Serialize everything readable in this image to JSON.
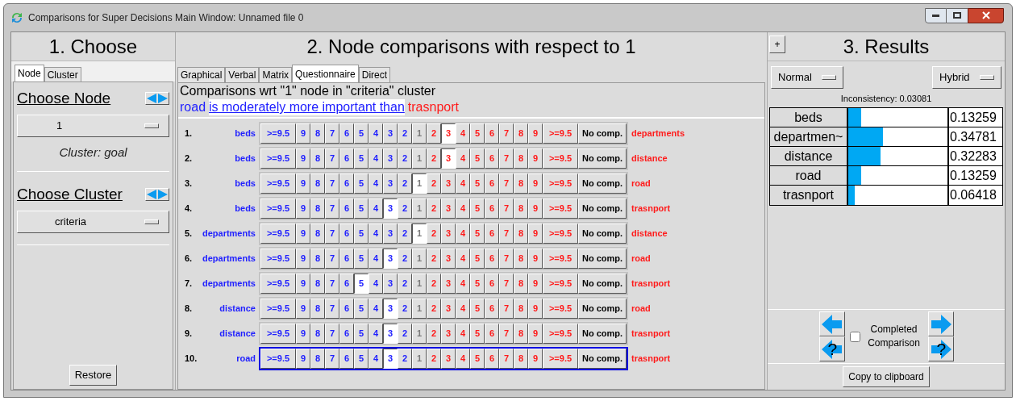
{
  "window": {
    "title": "Comparisons for Super Decisions Main Window: Unnamed file 0"
  },
  "choose": {
    "title": "1. Choose",
    "tabs": [
      {
        "label": "Node",
        "selected": true
      },
      {
        "label": "Cluster",
        "selected": false
      }
    ],
    "node_heading": "Choose Node",
    "node_value": "1",
    "cluster_note": "Cluster: goal",
    "cluster_heading": "Choose Cluster",
    "cluster_value": "criteria",
    "restore": "Restore"
  },
  "comparisons": {
    "title": "2. Node comparisons with respect to 1",
    "tabs": [
      {
        "label": "Graphical",
        "selected": false
      },
      {
        "label": "Verbal",
        "selected": false
      },
      {
        "label": "Matrix",
        "selected": false
      },
      {
        "label": "Questionnaire",
        "selected": true
      },
      {
        "label": "Direct",
        "selected": false
      }
    ],
    "heading": "Comparisons wrt \"1\" node in \"criteria\" cluster",
    "statement": {
      "left": "road",
      "verb": "is moderately more important than",
      "right": "trasnport"
    },
    "rows": [
      {
        "number": "1.",
        "left": "beds",
        "right": "departments",
        "active": false,
        "left_buttons": [
          {
            "label": ">=9.5",
            "selected": false
          },
          {
            "label": "9",
            "selected": false
          },
          {
            "label": "8",
            "selected": false
          },
          {
            "label": "7",
            "selected": false
          },
          {
            "label": "6",
            "selected": false
          },
          {
            "label": "5",
            "selected": false
          },
          {
            "label": "4",
            "selected": false
          },
          {
            "label": "3",
            "selected": false
          },
          {
            "label": "2",
            "selected": false
          }
        ],
        "equal": {
          "label": "1",
          "selected": false
        },
        "right_buttons": [
          {
            "label": "2",
            "selected": false
          },
          {
            "label": "3",
            "selected": true
          },
          {
            "label": "4",
            "selected": false
          },
          {
            "label": "5",
            "selected": false
          },
          {
            "label": "6",
            "selected": false
          },
          {
            "label": "7",
            "selected": false
          },
          {
            "label": "8",
            "selected": false
          },
          {
            "label": "9",
            "selected": false
          },
          {
            "label": ">=9.5",
            "selected": false
          }
        ],
        "no_comp": {
          "label": "No comp.",
          "selected": false
        }
      },
      {
        "number": "2.",
        "left": "beds",
        "right": "distance",
        "active": false,
        "left_buttons": [
          {
            "label": ">=9.5",
            "selected": false
          },
          {
            "label": "9",
            "selected": false
          },
          {
            "label": "8",
            "selected": false
          },
          {
            "label": "7",
            "selected": false
          },
          {
            "label": "6",
            "selected": false
          },
          {
            "label": "5",
            "selected": false
          },
          {
            "label": "4",
            "selected": false
          },
          {
            "label": "3",
            "selected": false
          },
          {
            "label": "2",
            "selected": false
          }
        ],
        "equal": {
          "label": "1",
          "selected": false
        },
        "right_buttons": [
          {
            "label": "2",
            "selected": false
          },
          {
            "label": "3",
            "selected": true
          },
          {
            "label": "4",
            "selected": false
          },
          {
            "label": "5",
            "selected": false
          },
          {
            "label": "6",
            "selected": false
          },
          {
            "label": "7",
            "selected": false
          },
          {
            "label": "8",
            "selected": false
          },
          {
            "label": "9",
            "selected": false
          },
          {
            "label": ">=9.5",
            "selected": false
          }
        ],
        "no_comp": {
          "label": "No comp.",
          "selected": false
        }
      },
      {
        "number": "3.",
        "left": "beds",
        "right": "road",
        "active": false,
        "left_buttons": [
          {
            "label": ">=9.5",
            "selected": false
          },
          {
            "label": "9",
            "selected": false
          },
          {
            "label": "8",
            "selected": false
          },
          {
            "label": "7",
            "selected": false
          },
          {
            "label": "6",
            "selected": false
          },
          {
            "label": "5",
            "selected": false
          },
          {
            "label": "4",
            "selected": false
          },
          {
            "label": "3",
            "selected": false
          },
          {
            "label": "2",
            "selected": false
          }
        ],
        "equal": {
          "label": "1",
          "selected": true
        },
        "right_buttons": [
          {
            "label": "2",
            "selected": false
          },
          {
            "label": "3",
            "selected": false
          },
          {
            "label": "4",
            "selected": false
          },
          {
            "label": "5",
            "selected": false
          },
          {
            "label": "6",
            "selected": false
          },
          {
            "label": "7",
            "selected": false
          },
          {
            "label": "8",
            "selected": false
          },
          {
            "label": "9",
            "selected": false
          },
          {
            "label": ">=9.5",
            "selected": false
          }
        ],
        "no_comp": {
          "label": "No comp.",
          "selected": false
        }
      },
      {
        "number": "4.",
        "left": "beds",
        "right": "trasnport",
        "active": false,
        "left_buttons": [
          {
            "label": ">=9.5",
            "selected": false
          },
          {
            "label": "9",
            "selected": false
          },
          {
            "label": "8",
            "selected": false
          },
          {
            "label": "7",
            "selected": false
          },
          {
            "label": "6",
            "selected": false
          },
          {
            "label": "5",
            "selected": false
          },
          {
            "label": "4",
            "selected": false
          },
          {
            "label": "3",
            "selected": true
          },
          {
            "label": "2",
            "selected": false
          }
        ],
        "equal": {
          "label": "1",
          "selected": false
        },
        "right_buttons": [
          {
            "label": "2",
            "selected": false
          },
          {
            "label": "3",
            "selected": false
          },
          {
            "label": "4",
            "selected": false
          },
          {
            "label": "5",
            "selected": false
          },
          {
            "label": "6",
            "selected": false
          },
          {
            "label": "7",
            "selected": false
          },
          {
            "label": "8",
            "selected": false
          },
          {
            "label": "9",
            "selected": false
          },
          {
            "label": ">=9.5",
            "selected": false
          }
        ],
        "no_comp": {
          "label": "No comp.",
          "selected": false
        }
      },
      {
        "number": "5.",
        "left": "departments",
        "right": "distance",
        "active": false,
        "left_buttons": [
          {
            "label": ">=9.5",
            "selected": false
          },
          {
            "label": "9",
            "selected": false
          },
          {
            "label": "8",
            "selected": false
          },
          {
            "label": "7",
            "selected": false
          },
          {
            "label": "6",
            "selected": false
          },
          {
            "label": "5",
            "selected": false
          },
          {
            "label": "4",
            "selected": false
          },
          {
            "label": "3",
            "selected": false
          },
          {
            "label": "2",
            "selected": false
          }
        ],
        "equal": {
          "label": "1",
          "selected": true
        },
        "right_buttons": [
          {
            "label": "2",
            "selected": false
          },
          {
            "label": "3",
            "selected": false
          },
          {
            "label": "4",
            "selected": false
          },
          {
            "label": "5",
            "selected": false
          },
          {
            "label": "6",
            "selected": false
          },
          {
            "label": "7",
            "selected": false
          },
          {
            "label": "8",
            "selected": false
          },
          {
            "label": "9",
            "selected": false
          },
          {
            "label": ">=9.5",
            "selected": false
          }
        ],
        "no_comp": {
          "label": "No comp.",
          "selected": false
        }
      },
      {
        "number": "6.",
        "left": "departments",
        "right": "road",
        "active": false,
        "left_buttons": [
          {
            "label": ">=9.5",
            "selected": false
          },
          {
            "label": "9",
            "selected": false
          },
          {
            "label": "8",
            "selected": false
          },
          {
            "label": "7",
            "selected": false
          },
          {
            "label": "6",
            "selected": false
          },
          {
            "label": "5",
            "selected": false
          },
          {
            "label": "4",
            "selected": false
          },
          {
            "label": "3",
            "selected": true
          },
          {
            "label": "2",
            "selected": false
          }
        ],
        "equal": {
          "label": "1",
          "selected": false
        },
        "right_buttons": [
          {
            "label": "2",
            "selected": false
          },
          {
            "label": "3",
            "selected": false
          },
          {
            "label": "4",
            "selected": false
          },
          {
            "label": "5",
            "selected": false
          },
          {
            "label": "6",
            "selected": false
          },
          {
            "label": "7",
            "selected": false
          },
          {
            "label": "8",
            "selected": false
          },
          {
            "label": "9",
            "selected": false
          },
          {
            "label": ">=9.5",
            "selected": false
          }
        ],
        "no_comp": {
          "label": "No comp.",
          "selected": false
        }
      },
      {
        "number": "7.",
        "left": "departments",
        "right": "trasnport",
        "active": false,
        "left_buttons": [
          {
            "label": ">=9.5",
            "selected": false
          },
          {
            "label": "9",
            "selected": false
          },
          {
            "label": "8",
            "selected": false
          },
          {
            "label": "7",
            "selected": false
          },
          {
            "label": "6",
            "selected": false
          },
          {
            "label": "5",
            "selected": true
          },
          {
            "label": "4",
            "selected": false
          },
          {
            "label": "3",
            "selected": false
          },
          {
            "label": "2",
            "selected": false
          }
        ],
        "equal": {
          "label": "1",
          "selected": false
        },
        "right_buttons": [
          {
            "label": "2",
            "selected": false
          },
          {
            "label": "3",
            "selected": false
          },
          {
            "label": "4",
            "selected": false
          },
          {
            "label": "5",
            "selected": false
          },
          {
            "label": "6",
            "selected": false
          },
          {
            "label": "7",
            "selected": false
          },
          {
            "label": "8",
            "selected": false
          },
          {
            "label": "9",
            "selected": false
          },
          {
            "label": ">=9.5",
            "selected": false
          }
        ],
        "no_comp": {
          "label": "No comp.",
          "selected": false
        }
      },
      {
        "number": "8.",
        "left": "distance",
        "right": "road",
        "active": false,
        "left_buttons": [
          {
            "label": ">=9.5",
            "selected": false
          },
          {
            "label": "9",
            "selected": false
          },
          {
            "label": "8",
            "selected": false
          },
          {
            "label": "7",
            "selected": false
          },
          {
            "label": "6",
            "selected": false
          },
          {
            "label": "5",
            "selected": false
          },
          {
            "label": "4",
            "selected": false
          },
          {
            "label": "3",
            "selected": true
          },
          {
            "label": "2",
            "selected": false
          }
        ],
        "equal": {
          "label": "1",
          "selected": false
        },
        "right_buttons": [
          {
            "label": "2",
            "selected": false
          },
          {
            "label": "3",
            "selected": false
          },
          {
            "label": "4",
            "selected": false
          },
          {
            "label": "5",
            "selected": false
          },
          {
            "label": "6",
            "selected": false
          },
          {
            "label": "7",
            "selected": false
          },
          {
            "label": "8",
            "selected": false
          },
          {
            "label": "9",
            "selected": false
          },
          {
            "label": ">=9.5",
            "selected": false
          }
        ],
        "no_comp": {
          "label": "No comp.",
          "selected": false
        }
      },
      {
        "number": "9.",
        "left": "distance",
        "right": "trasnport",
        "active": false,
        "left_buttons": [
          {
            "label": ">=9.5",
            "selected": false
          },
          {
            "label": "9",
            "selected": false
          },
          {
            "label": "8",
            "selected": false
          },
          {
            "label": "7",
            "selected": false
          },
          {
            "label": "6",
            "selected": false
          },
          {
            "label": "5",
            "selected": false
          },
          {
            "label": "4",
            "selected": false
          },
          {
            "label": "3",
            "selected": true
          },
          {
            "label": "2",
            "selected": false
          }
        ],
        "equal": {
          "label": "1",
          "selected": false
        },
        "right_buttons": [
          {
            "label": "2",
            "selected": false
          },
          {
            "label": "3",
            "selected": false
          },
          {
            "label": "4",
            "selected": false
          },
          {
            "label": "5",
            "selected": false
          },
          {
            "label": "6",
            "selected": false
          },
          {
            "label": "7",
            "selected": false
          },
          {
            "label": "8",
            "selected": false
          },
          {
            "label": "9",
            "selected": false
          },
          {
            "label": ">=9.5",
            "selected": false
          }
        ],
        "no_comp": {
          "label": "No comp.",
          "selected": false
        }
      },
      {
        "number": "10.",
        "left": "road",
        "right": "trasnport",
        "active": true,
        "left_buttons": [
          {
            "label": ">=9.5",
            "selected": false
          },
          {
            "label": "9",
            "selected": false
          },
          {
            "label": "8",
            "selected": false
          },
          {
            "label": "7",
            "selected": false
          },
          {
            "label": "6",
            "selected": false
          },
          {
            "label": "5",
            "selected": false
          },
          {
            "label": "4",
            "selected": false
          },
          {
            "label": "3",
            "selected": true
          },
          {
            "label": "2",
            "selected": false
          }
        ],
        "equal": {
          "label": "1",
          "selected": false
        },
        "right_buttons": [
          {
            "label": "2",
            "selected": false
          },
          {
            "label": "3",
            "selected": false
          },
          {
            "label": "4",
            "selected": false
          },
          {
            "label": "5",
            "selected": false
          },
          {
            "label": "6",
            "selected": false
          },
          {
            "label": "7",
            "selected": false
          },
          {
            "label": "8",
            "selected": false
          },
          {
            "label": "9",
            "selected": false
          },
          {
            "label": ">=9.5",
            "selected": false
          }
        ],
        "no_comp": {
          "label": "No comp.",
          "selected": false
        }
      }
    ]
  },
  "results": {
    "title": "3. Results",
    "expand": "+",
    "mode": "Normal",
    "method": "Hybrid",
    "inconsistency": "Inconsistency: 0.03081",
    "items": [
      {
        "name": "beds",
        "level": 0.13259,
        "value": "0.13259"
      },
      {
        "name": "departmen~",
        "level": 0.34781,
        "value": "0.34781"
      },
      {
        "name": "distance",
        "level": 0.32283,
        "value": "0.32283"
      },
      {
        "name": "road",
        "level": 0.13259,
        "value": "0.13259"
      },
      {
        "name": "trasnport",
        "level": 0.06418,
        "value": "0.06418"
      }
    ],
    "previous_unfinished_mark": "?",
    "next_unfinished_mark": "?",
    "completed": {
      "label": "Completed Comparison",
      "checked": false
    },
    "copy": "Copy to clipboard"
  }
}
